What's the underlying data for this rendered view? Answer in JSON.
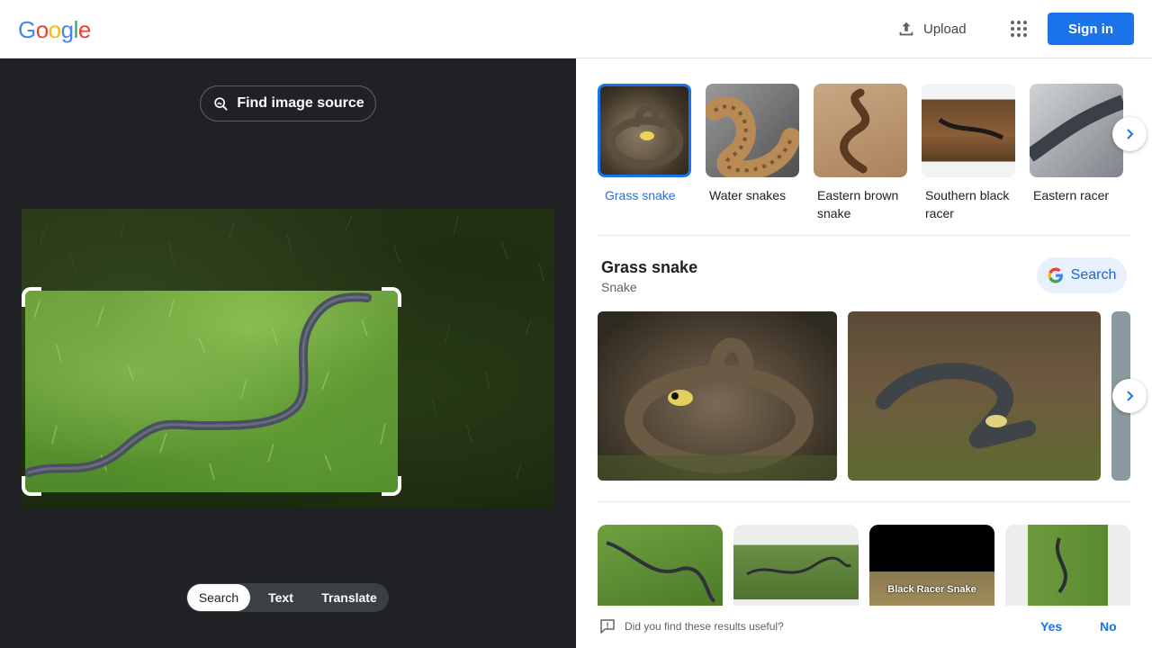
{
  "header": {
    "logo_letters": [
      "G",
      "o",
      "o",
      "g",
      "l",
      "e"
    ],
    "logo_colors": [
      "#4285F4",
      "#EA4335",
      "#FBBC05",
      "#4285F4",
      "#34A853",
      "#EA4335"
    ],
    "upload_label": "Upload",
    "signin_label": "Sign in"
  },
  "left": {
    "find_source_label": "Find image source",
    "modes": [
      "Search",
      "Text",
      "Translate"
    ],
    "active_mode": "Search"
  },
  "related": [
    {
      "label": "Grass snake",
      "selected": true
    },
    {
      "label": "Water snakes",
      "selected": false
    },
    {
      "label": "Eastern brown snake",
      "selected": false
    },
    {
      "label": "Southern black racer",
      "selected": false
    },
    {
      "label": "Eastern racer",
      "selected": false
    }
  ],
  "knowledge": {
    "title": "Grass snake",
    "subtitle": "Snake",
    "search_label": "Search"
  },
  "results": {
    "thumb_caption": "Black Racer Snake"
  },
  "feedback": {
    "question": "Did you find these results useful?",
    "yes": "Yes",
    "no": "No"
  },
  "colors": {
    "accent": "#1a73e8",
    "dark_panel": "#202124"
  }
}
